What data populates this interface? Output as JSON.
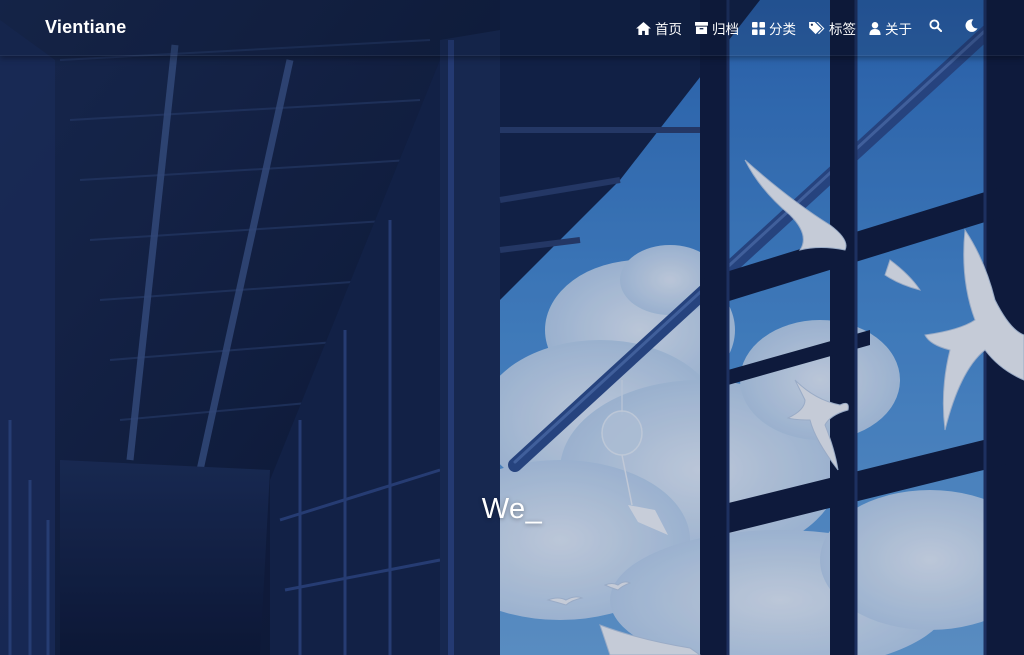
{
  "site": {
    "brand": "Vientiane"
  },
  "nav": {
    "items": [
      {
        "label": "首页",
        "icon": "home-icon"
      },
      {
        "label": "归档",
        "icon": "archive-icon"
      },
      {
        "label": "分类",
        "icon": "category-icon"
      },
      {
        "label": "标签",
        "icon": "tags-icon"
      },
      {
        "label": "关于",
        "icon": "user-icon"
      }
    ],
    "search_icon": "search-icon",
    "theme_icon": "moon-icon"
  },
  "banner": {
    "text": "We_"
  },
  "colors": {
    "nav_text": "#ffffff",
    "sky": "#4a8fd6",
    "structure": "#0f1c3d"
  }
}
